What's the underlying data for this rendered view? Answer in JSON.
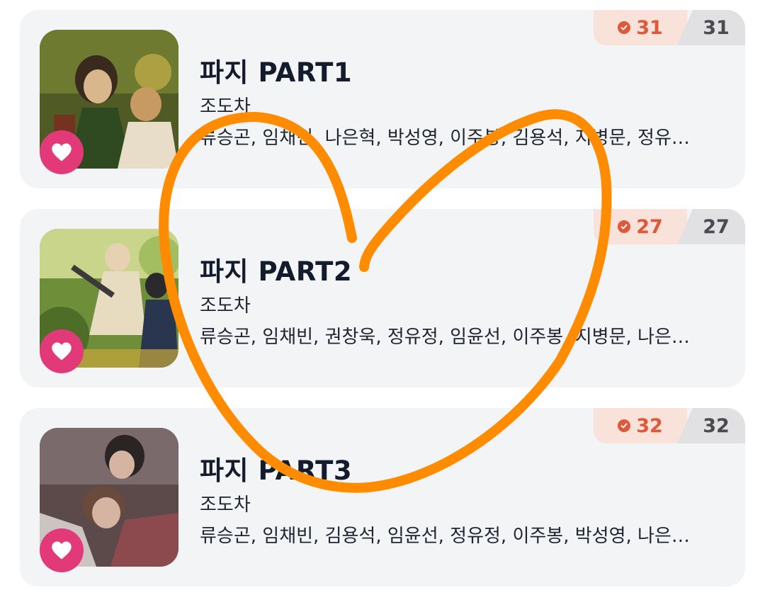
{
  "items": [
    {
      "title": "파지 PART1",
      "author": "조도차",
      "cast": "류승곤, 임채빈, 나은혁, 박성영, 이주봉, 김용석, 지병문, 정유…",
      "read_count": "31",
      "total_count": "31",
      "cover_colors": {
        "bg": "#5e6a2c",
        "accent": "#9aa34a",
        "figure": "#d9b78d"
      }
    },
    {
      "title": "파지 PART2",
      "author": "조도차",
      "cast": "류승곤, 임채빈, 권창욱, 정유정, 임윤선, 이주봉, 지병문, 나은…",
      "read_count": "27",
      "total_count": "27",
      "cover_colors": {
        "bg": "#6f8e3a",
        "accent": "#c9d58a",
        "figure": "#e6d2b2"
      }
    },
    {
      "title": "파지 PART3",
      "author": "조도차",
      "cast": "류승곤, 임채빈, 김용석, 임윤선, 정유정, 이주봉, 박성영, 나은…",
      "read_count": "32",
      "total_count": "32",
      "cover_colors": {
        "bg": "#5c4a4a",
        "accent": "#8c6a6e",
        "figure": "#d6b4a2"
      }
    }
  ],
  "icons": {
    "favorite": "heart-icon",
    "read_status": "check-circle-icon"
  },
  "colors": {
    "favorite_bg": "#e23a78",
    "read_badge_text": "#e0573a",
    "drawing_stroke": "#ff8c00"
  }
}
